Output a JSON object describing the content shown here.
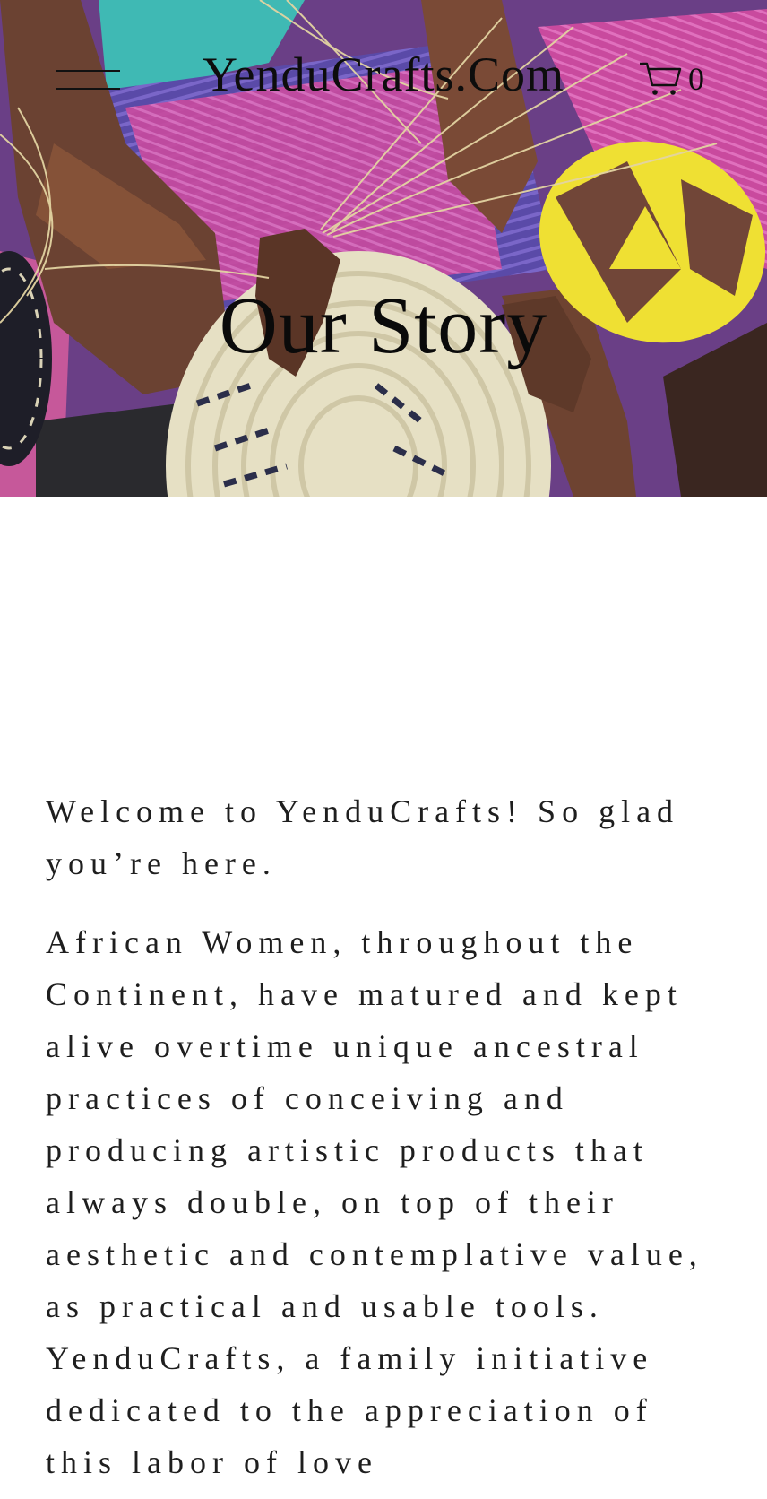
{
  "header": {
    "site_title": "YenduCrafts.Com",
    "cart_count": "0",
    "menu_icon": "hamburger-menu-icon",
    "cart_icon": "shopping-cart-icon"
  },
  "hero": {
    "heading": "Our Story",
    "image": "woven-baskets-photo"
  },
  "content": {
    "welcome": "Welcome to YenduCrafts! So glad you’re here.",
    "story": "African Women, throughout the Continent, have matured and kept alive overtime unique ancestral practices of conceiving and producing artistic products that always double, on top of their aesthetic and contemplative value, as practical and usable tools. YenduCrafts, a family initiative dedicated to the appreciation of this labor of love"
  },
  "colors": {
    "text": "#1e1e1e",
    "background": "#ffffff",
    "basket_yellow": "#e9dc2a",
    "basket_pink": "#d24fa6",
    "basket_cream": "#e6e0c8"
  }
}
